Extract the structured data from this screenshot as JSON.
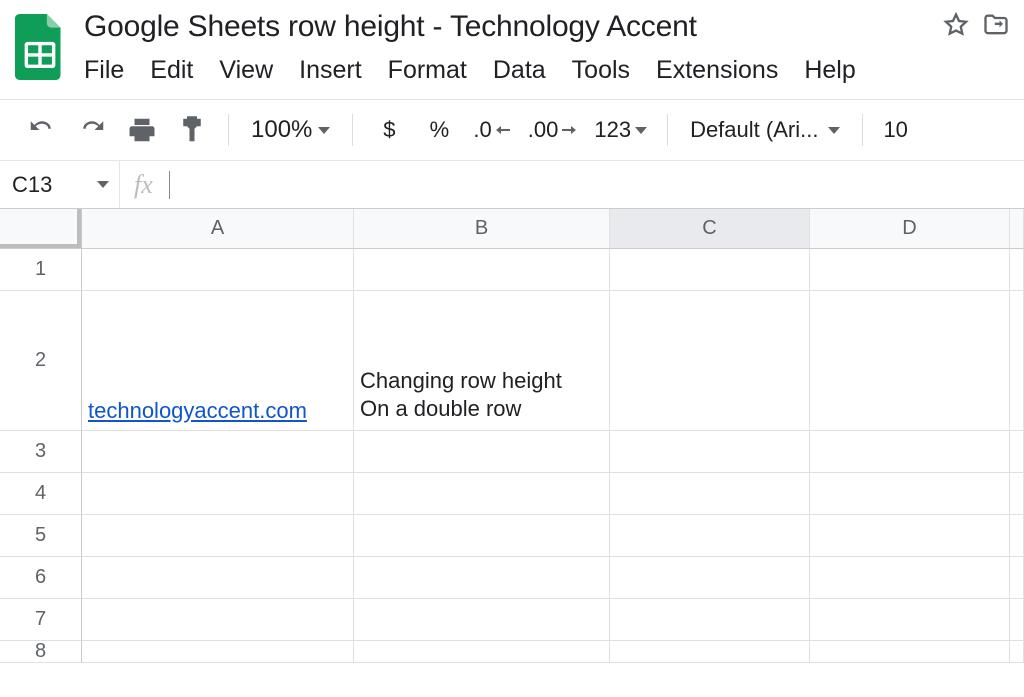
{
  "doc": {
    "title": "Google Sheets row height - Technology Accent"
  },
  "menu": {
    "file": "File",
    "edit": "Edit",
    "view": "View",
    "insert": "Insert",
    "format": "Format",
    "data": "Data",
    "tools": "Tools",
    "extensions": "Extensions",
    "help": "Help"
  },
  "toolbar": {
    "zoom": "100%",
    "currency": "$",
    "percent": "%",
    "dec_dec": ".0",
    "inc_dec": ".00",
    "num_format": "123",
    "font": "Default (Ari...",
    "font_size": "10"
  },
  "namebox": {
    "ref": "C13"
  },
  "fx": {
    "label": "fx"
  },
  "columns": [
    "A",
    "B",
    "C",
    "D"
  ],
  "rows": [
    "1",
    "2",
    "3",
    "4",
    "5",
    "6",
    "7",
    "8"
  ],
  "cells": {
    "A2": "technologyaccent.com",
    "B2": "Changing row height\nOn a double row"
  }
}
